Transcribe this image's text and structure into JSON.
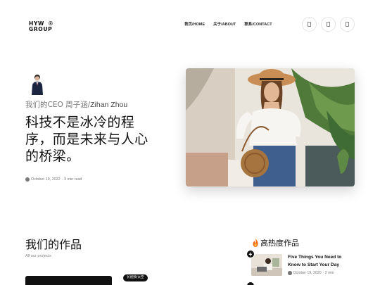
{
  "header": {
    "logo_line1": "HYW",
    "logo_line2": "GROUP",
    "logo_mark": "®",
    "nav": [
      {
        "label": "首页/HOME"
      },
      {
        "label": "关于/ABOUT"
      },
      {
        "label": "联系/CONTACT"
      }
    ],
    "icons": [
      "social-icon-1",
      "social-icon-2",
      "social-icon-3"
    ]
  },
  "hero": {
    "ceo_prefix": "我们的CEO 周子涵/",
    "ceo_name": "Zihan Zhou",
    "headline": "科技不是冰冷的程序，而是未来与人心的桥梁。",
    "date": "October 19, 2022",
    "read_time": "· 3 min read"
  },
  "works": {
    "title": "我们的作品",
    "subtitle": "All our projects",
    "tag": "长视频/太空"
  },
  "hot": {
    "title": "高热度作品",
    "post_title": "Five Things You Need to Know to Start Your Day",
    "post_date": "October 19, 2020",
    "post_read": "- 2 min"
  }
}
